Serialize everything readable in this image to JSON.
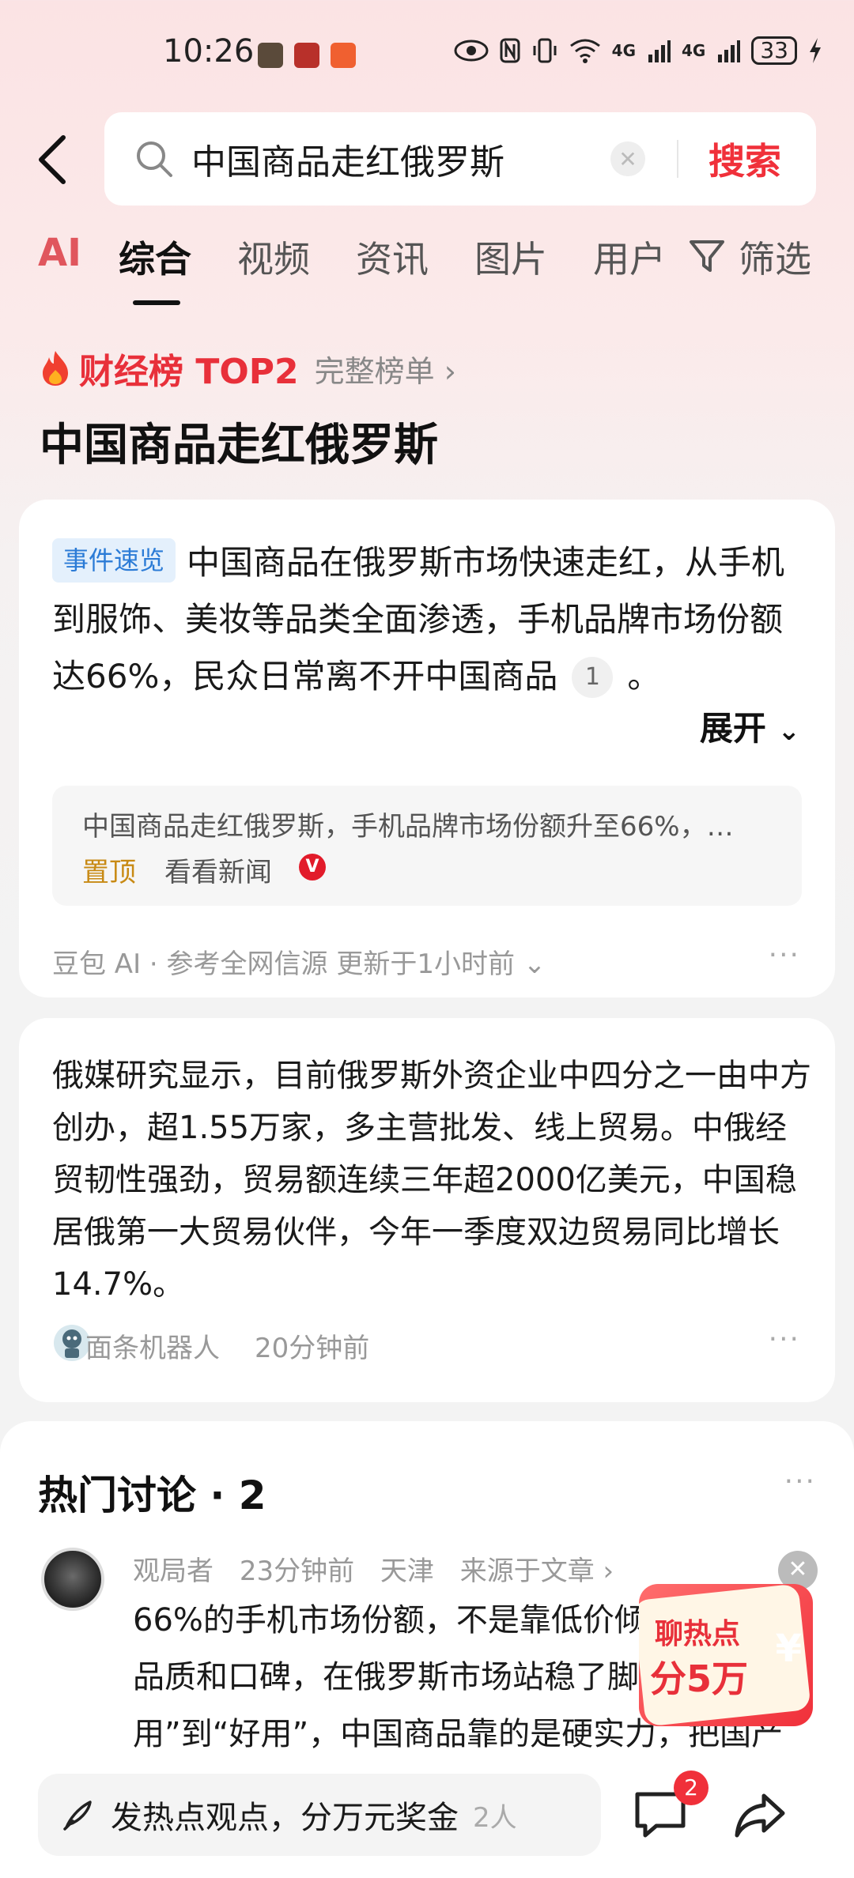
{
  "status": {
    "time": "10:26",
    "battery": "33",
    "net1": "4G",
    "net2": "4G"
  },
  "search": {
    "query": "中国商品走红俄罗斯",
    "button": "搜索"
  },
  "tabs": [
    {
      "label": "AI"
    },
    {
      "label": "综合"
    },
    {
      "label": "视频"
    },
    {
      "label": "资讯"
    },
    {
      "label": "图片"
    },
    {
      "label": "用户"
    },
    {
      "label": "筛选"
    }
  ],
  "rank": {
    "title": "财经榜 TOP2",
    "link": "完整榜单 ›"
  },
  "topic_title": "中国商品走红俄罗斯",
  "event_card": {
    "tag": "事件速览",
    "text": "中国商品在俄罗斯市场快速走红，从手机到服饰、美妆等品类全面渗透，手机品牌市场份额达66%，民众日常离不开中国商品",
    "ref": "1",
    "tail": "。",
    "expand": "展开",
    "quote": "中国商品走红俄罗斯，手机品牌市场份额升至66%，…",
    "pin": "置顶",
    "news": "看看新闻",
    "vbadge": "V",
    "footer": "豆包 AI · 参考全网信源 更新于1小时前 ⌄",
    "more": "···"
  },
  "news_card": {
    "text": "俄媒研究显示，目前俄罗斯外资企业中四分之一由中方创办，超1.55万家，多主营批发、线上贸易。中俄经贸韧性强劲，贸易额连续三年超2000亿美元，中国稳居俄第一大贸易伙伴，今年一季度双边贸易同比增长14.7%。",
    "author": "面条机器人",
    "time": "20分钟前",
    "more": "···"
  },
  "discussion": {
    "title": "热门讨论 · 2",
    "more": "···",
    "user": "观局者",
    "time": "23分钟前",
    "location": "天津",
    "source": "来源于文章 ›",
    "comment": "66%的手机市场份额，不是靠低价倾销，而是靠品质和口碑，在俄罗斯市场站稳了脚跟，从“能用”到“好用”，中国商品靠的是硬实力，把国产"
  },
  "red_packet": {
    "line1": "聊热点",
    "line2": "分5万",
    "yen": "¥",
    "close": "✕"
  },
  "bottom": {
    "compose": "发热点观点，分万元奖金",
    "count": "2人",
    "comment_badge": "2"
  }
}
